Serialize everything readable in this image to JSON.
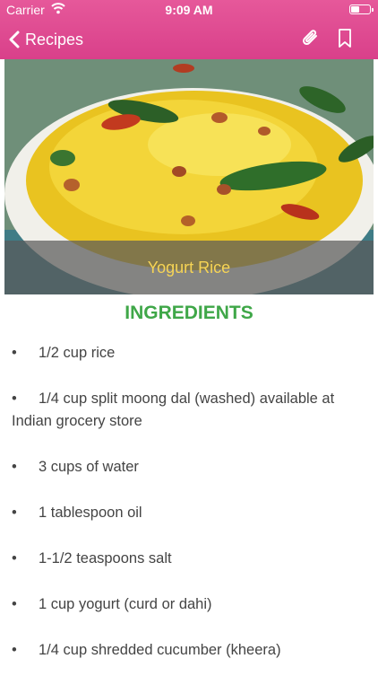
{
  "status_bar": {
    "carrier": "Carrier",
    "time": "9:09 AM"
  },
  "nav": {
    "back_label": "Recipes"
  },
  "hero": {
    "caption": "Yogurt Rice"
  },
  "ingredients": {
    "title": "INGREDIENTS",
    "bullet": "•",
    "items": [
      "1/2 cup rice",
      "1/4 cup split moong dal (washed) available at Indian grocery store",
      "3 cups of water",
      "1 tablespoon oil",
      "1-1/2 teaspoons salt",
      "1 cup yogurt (curd or dahi)",
      "1/4 cup shredded cucumber (kheera)"
    ]
  },
  "icons": {
    "back": "chevron-left-icon",
    "attach": "paperclip-icon",
    "bookmark": "bookmark-icon",
    "wifi": "wifi-icon",
    "battery": "battery-icon"
  },
  "colors": {
    "nav_bar": "#dd4c8f",
    "title_green": "#3fa748",
    "caption_text": "#f6d455"
  }
}
